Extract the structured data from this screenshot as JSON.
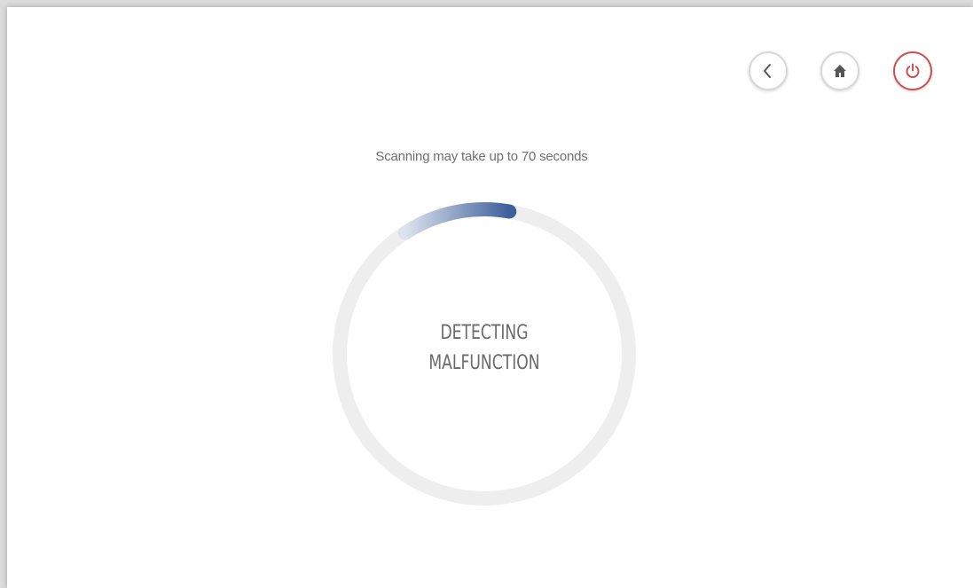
{
  "nav": {
    "back_icon": "chevron-left-icon",
    "home_icon": "home-icon",
    "power_icon": "power-icon",
    "power_color": "#c9504f",
    "button_border_color": "#d8d8d8"
  },
  "scan": {
    "hint": "Scanning may take up to 70 seconds",
    "status_line1": "DETECTING",
    "status_line2": "MALFUNCTION",
    "progress_fraction": 0.12,
    "progress_color": "#3e5f9b",
    "track_color": "#eeeeee"
  }
}
